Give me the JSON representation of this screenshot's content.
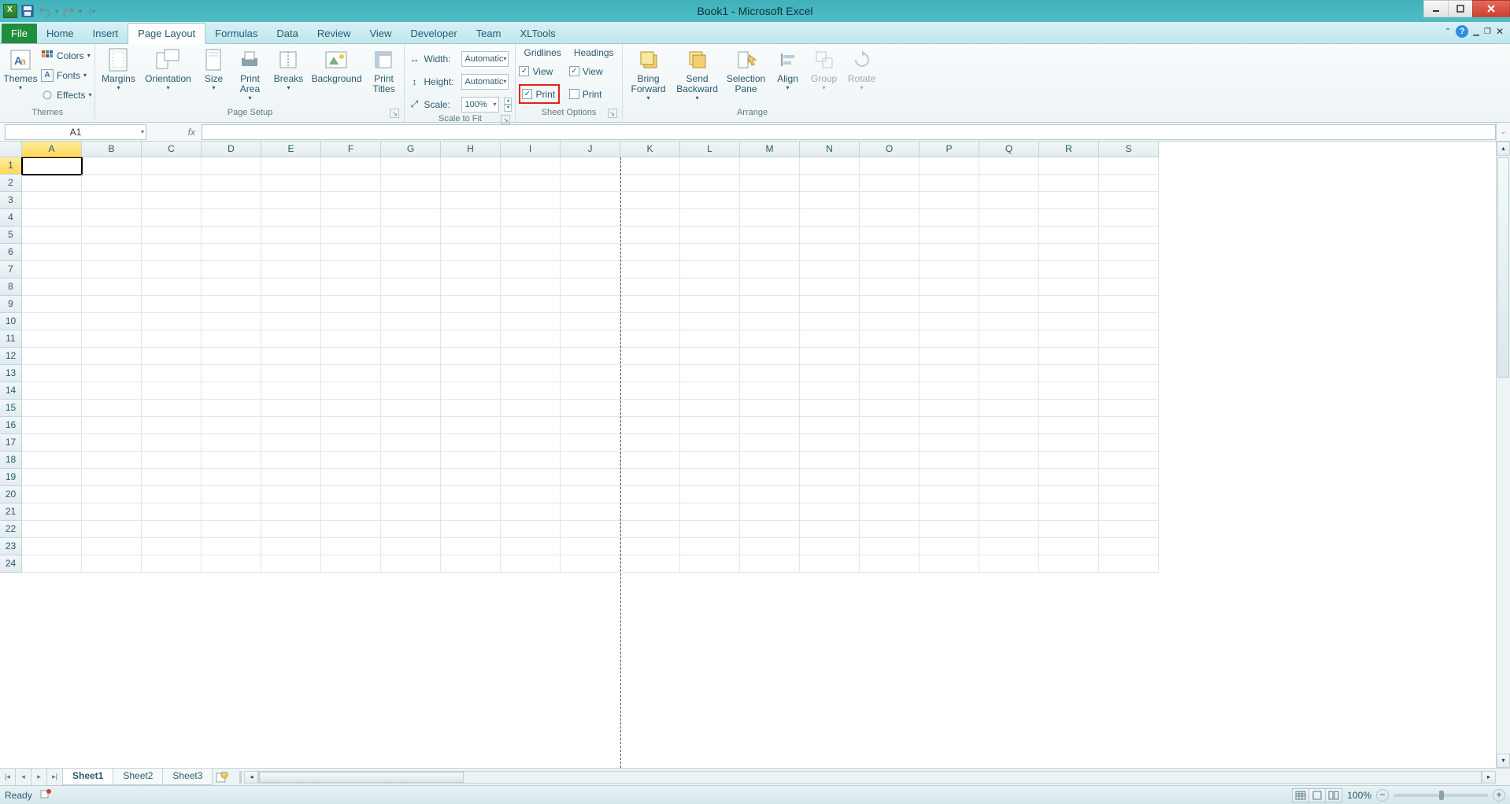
{
  "title": "Book1 - Microsoft Excel",
  "tabs": {
    "file": "File",
    "home": "Home",
    "insert": "Insert",
    "pagelayout": "Page Layout",
    "formulas": "Formulas",
    "data": "Data",
    "review": "Review",
    "view": "View",
    "developer": "Developer",
    "team": "Team",
    "xltools": "XLTools"
  },
  "ribbon": {
    "themes": {
      "label": "Themes",
      "themes_btn": "Themes",
      "colors": "Colors",
      "fonts": "Fonts",
      "effects": "Effects"
    },
    "pagesetup": {
      "label": "Page Setup",
      "margins": "Margins",
      "orientation": "Orientation",
      "size": "Size",
      "printarea": "Print\nArea",
      "breaks": "Breaks",
      "background": "Background",
      "printtitles": "Print\nTitles"
    },
    "scale": {
      "label": "Scale to Fit",
      "width_lbl": "Width:",
      "width_val": "Automatic",
      "height_lbl": "Height:",
      "height_val": "Automatic",
      "scale_lbl": "Scale:",
      "scale_val": "100%"
    },
    "sheetopts": {
      "label": "Sheet Options",
      "gridlines": "Gridlines",
      "headings": "Headings",
      "view": "View",
      "print": "Print"
    },
    "arrange": {
      "label": "Arrange",
      "bringfwd": "Bring\nForward",
      "sendback": "Send\nBackward",
      "selpane": "Selection\nPane",
      "align": "Align",
      "group": "Group",
      "rotate": "Rotate"
    }
  },
  "namebox": "A1",
  "columns": [
    "A",
    "B",
    "C",
    "D",
    "E",
    "F",
    "G",
    "H",
    "I",
    "J",
    "K",
    "L",
    "M",
    "N",
    "O",
    "P",
    "Q",
    "R",
    "S"
  ],
  "rows": [
    1,
    2,
    3,
    4,
    5,
    6,
    7,
    8,
    9,
    10,
    11,
    12,
    13,
    14,
    15,
    16,
    17,
    18,
    19,
    20,
    21,
    22,
    23,
    24
  ],
  "sheets": {
    "s1": "Sheet1",
    "s2": "Sheet2",
    "s3": "Sheet3"
  },
  "status": {
    "ready": "Ready",
    "zoom": "100%"
  }
}
